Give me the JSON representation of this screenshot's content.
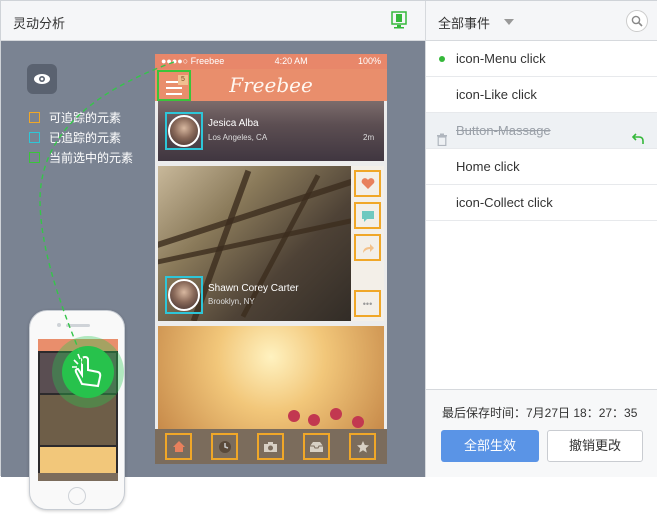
{
  "app": {
    "title": "灵动分析"
  },
  "legend": [
    {
      "label": "可追踪的元素",
      "color": "#f0a728"
    },
    {
      "label": "已追踪的元素",
      "color": "#2ec6d8"
    },
    {
      "label": "当前选中的元素",
      "color": "#3ac43a"
    }
  ],
  "phone": {
    "carrier": "●●●●○ Freebee",
    "clock": "4:20 AM",
    "battery": "100%",
    "app_title": "Freebee",
    "menu_badge": "5",
    "card1": {
      "name": "Jesica Alba",
      "location": "Los Angeles, CA",
      "time": "2m"
    },
    "card2": {
      "name": "Shawn Corey Carter",
      "location": "Brooklyn, NY"
    },
    "more_glyph": "•••"
  },
  "sidebar": {
    "filter": "全部事件",
    "events": [
      {
        "label": "icon-Menu click",
        "active": true,
        "deleted": false
      },
      {
        "label": "icon-Like click",
        "active": false,
        "deleted": false
      },
      {
        "label": "Button-Massage",
        "active": false,
        "deleted": true
      },
      {
        "label": "Home click",
        "active": false,
        "deleted": false
      },
      {
        "label": "icon-Collect click",
        "active": false,
        "deleted": false
      }
    ],
    "saved_time": "最后保存时间：7月27日  18：27：35",
    "apply_label": "全部生效",
    "revert_label": "撤销更改"
  },
  "colors": {
    "accent": "#5a94e6",
    "green": "#35b83a",
    "orange": "#f0a728",
    "cyan": "#2ec6d8",
    "navbar": "#e98e6c"
  },
  "icons": [
    "eye-icon",
    "device-icon",
    "search-icon",
    "trash-icon",
    "undo-icon",
    "menu-icon",
    "heart-icon",
    "comment-icon",
    "share-icon",
    "more-icon",
    "home-icon",
    "clock-icon",
    "camera-icon",
    "inbox-icon",
    "star-icon",
    "hand-pointer-icon"
  ]
}
